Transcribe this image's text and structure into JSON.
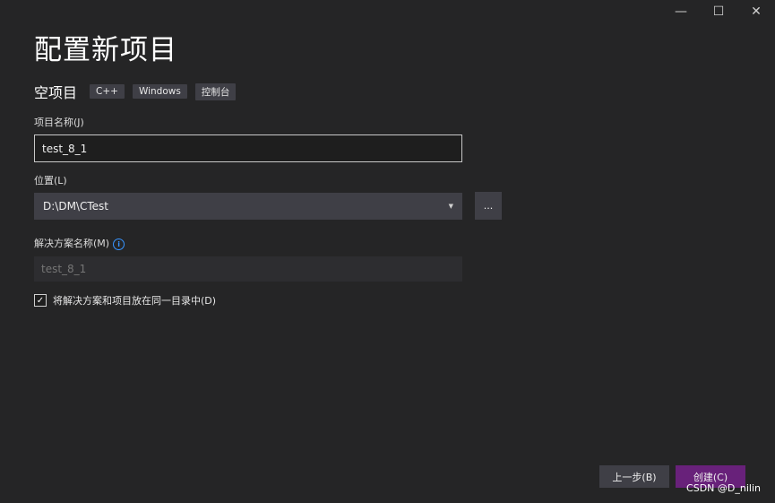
{
  "window_controls": {
    "minimize": "—",
    "maximize": "☐",
    "close": "✕"
  },
  "page_title": "配置新项目",
  "template": {
    "name": "空项目",
    "tags": [
      "C++",
      "Windows",
      "控制台"
    ]
  },
  "project_name": {
    "label": "项目名称(J)",
    "value": "test_8_1"
  },
  "location": {
    "label": "位置(L)",
    "value": "D:\\DM\\CTest",
    "browse_label": "..."
  },
  "solution_name": {
    "label": "解决方案名称(M)",
    "placeholder": "test_8_1"
  },
  "same_directory": {
    "checked": true,
    "label": "将解决方案和项目放在同一目录中(D)"
  },
  "buttons": {
    "back": "上一步(B)",
    "create": "创建(C)"
  },
  "watermark": "CSDN @D_nilin",
  "colors": {
    "accent": "#68217a",
    "info": "#3794ff",
    "background": "#252526"
  }
}
